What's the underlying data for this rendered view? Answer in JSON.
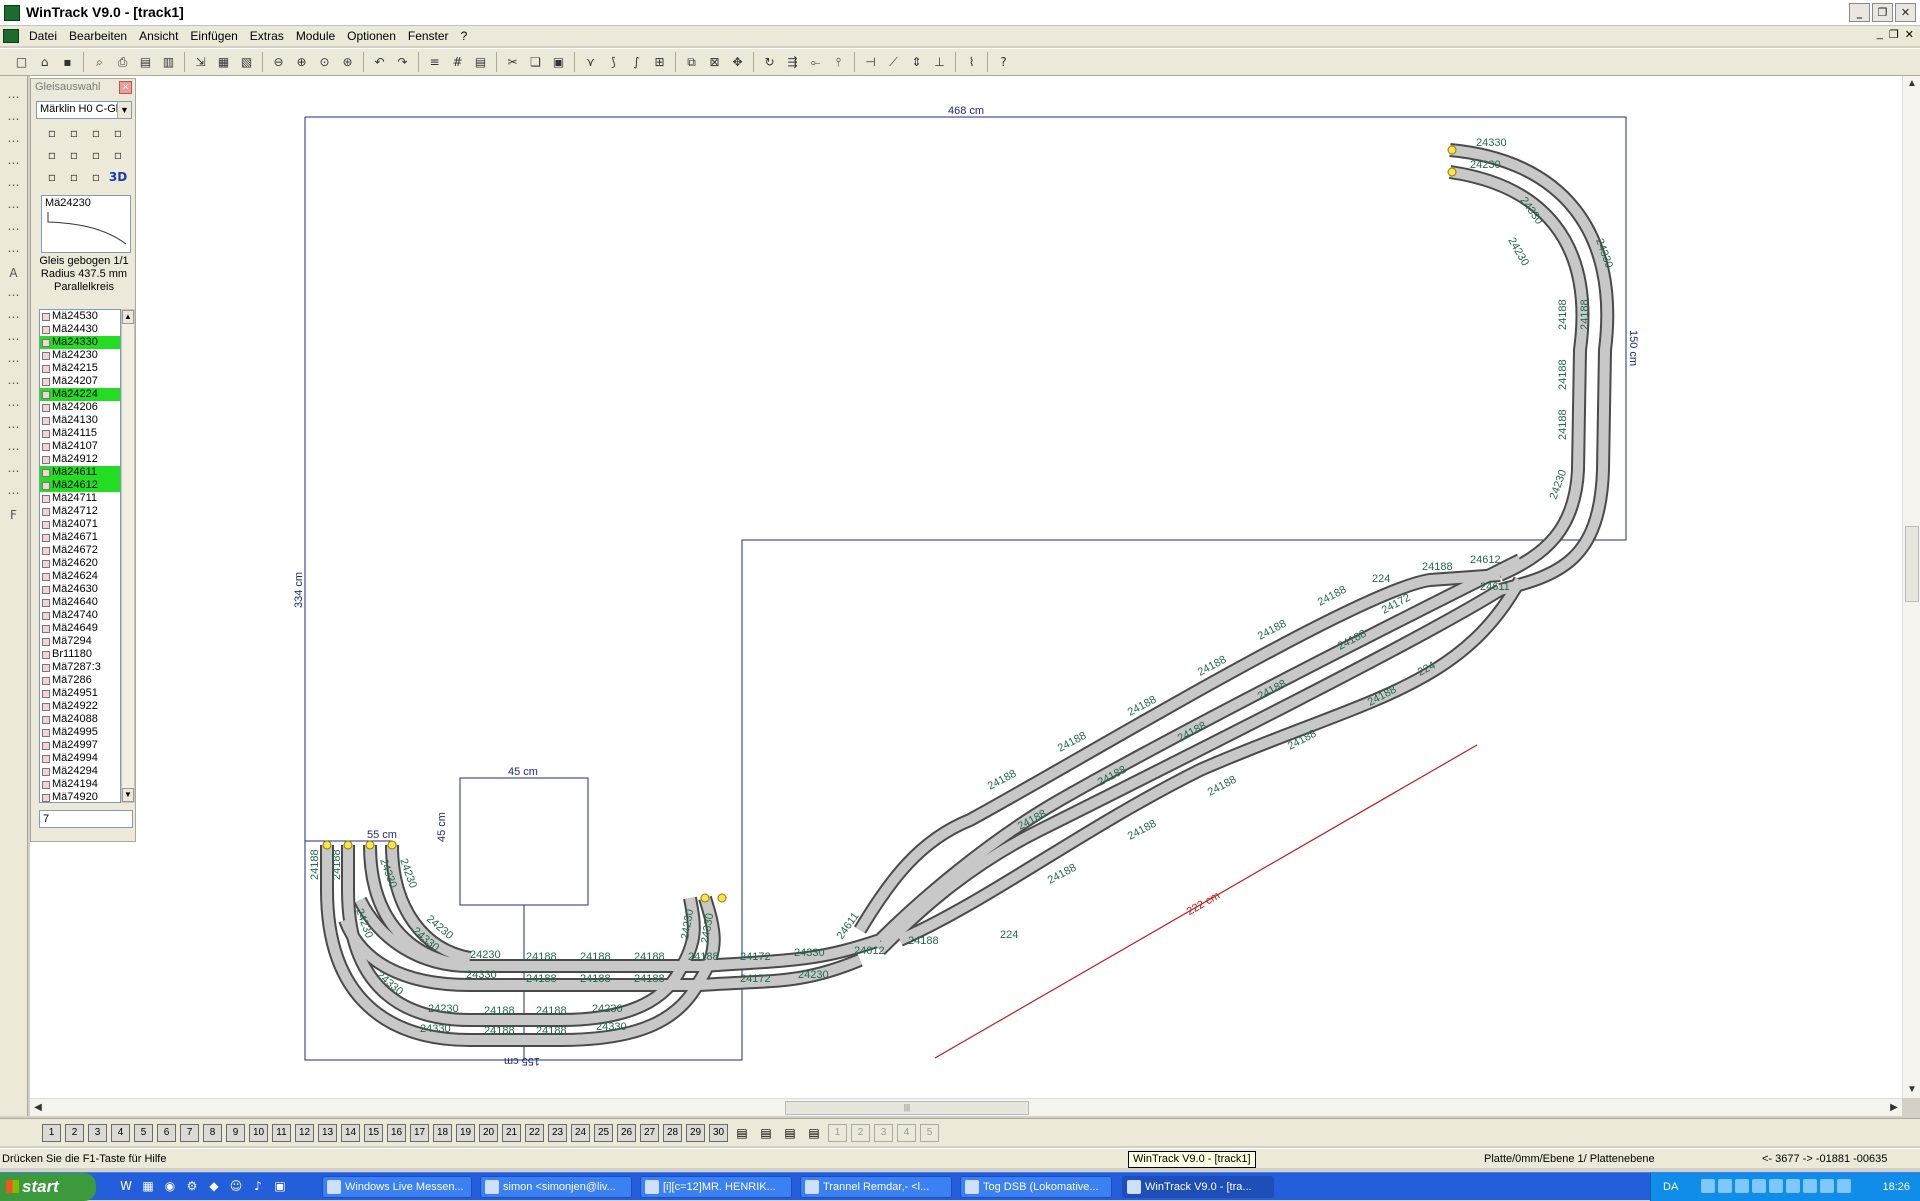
{
  "window": {
    "title": "WinTrack  V9.0 - [track1]"
  },
  "menu": [
    "Datei",
    "Bearbeiten",
    "Ansicht",
    "Einfügen",
    "Extras",
    "Module",
    "Optionen",
    "Fenster",
    "?"
  ],
  "toolbar_icons": [
    "new-icon",
    "open-icon",
    "save-icon",
    "print-preview-icon",
    "print-icon",
    "page-setup-icon",
    "properties-icon",
    "import-icon",
    "statistics-icon",
    "picture-icon",
    "zoom-out-icon",
    "zoom-in-icon",
    "zoom-window-icon",
    "zoom-all-icon",
    "undo-icon",
    "redo-icon",
    "parts-list-icon",
    "grid-icon",
    "table-icon",
    "cut-icon",
    "copy-icon",
    "paste-icon",
    "switch-icon",
    "curve-icon",
    "flex-icon",
    "insert-icon",
    "duplicate-icon",
    "delete-icon",
    "move-icon",
    "rotate-icon",
    "align-icon",
    "connect-icon",
    "split-icon",
    "join-icon",
    "slope-icon",
    "height-icon",
    "level-icon",
    "terrain-icon",
    "help-icon"
  ],
  "panel": {
    "title": "Gleisauswahl",
    "manufacturer": "Märklin H0 C-Gleis",
    "selected_item": "Mä24230",
    "info_lines": [
      "Gleis gebogen 1/1",
      "Radius 437.5 mm",
      "Parallelkreis"
    ],
    "list": [
      {
        "name": "Mä24530",
        "hl": false
      },
      {
        "name": "Mä24430",
        "hl": false
      },
      {
        "name": "Mä24330",
        "hl": true
      },
      {
        "name": "Mä24230",
        "hl": false
      },
      {
        "name": "Mä24215",
        "hl": false
      },
      {
        "name": "Mä24207",
        "hl": false
      },
      {
        "name": "Mä24224",
        "hl": true
      },
      {
        "name": "Mä24206",
        "hl": false
      },
      {
        "name": "Mä24130",
        "hl": false
      },
      {
        "name": "Mä24115",
        "hl": false
      },
      {
        "name": "Mä24107",
        "hl": false
      },
      {
        "name": "Mä24912",
        "hl": false
      },
      {
        "name": "Mä24611",
        "hl": true
      },
      {
        "name": "Mä24612",
        "hl": true
      },
      {
        "name": "Mä24711",
        "hl": false
      },
      {
        "name": "Mä24712",
        "hl": false
      },
      {
        "name": "Mä24071",
        "hl": false
      },
      {
        "name": "Mä24671",
        "hl": false
      },
      {
        "name": "Mä24672",
        "hl": false
      },
      {
        "name": "Mä24620",
        "hl": false
      },
      {
        "name": "Mä24624",
        "hl": false
      },
      {
        "name": "Mä24630",
        "hl": false
      },
      {
        "name": "Mä24640",
        "hl": false
      },
      {
        "name": "Mä24740",
        "hl": false
      },
      {
        "name": "Mä24649",
        "hl": false
      },
      {
        "name": "Mä7294",
        "hl": false
      },
      {
        "name": "Br11180",
        "hl": false
      },
      {
        "name": "Mä7287:3",
        "hl": false
      },
      {
        "name": "Mä7286",
        "hl": false
      },
      {
        "name": "Mä24951",
        "hl": false
      },
      {
        "name": "Mä24922",
        "hl": false
      },
      {
        "name": "Mä24088",
        "hl": false
      },
      {
        "name": "Mä24995",
        "hl": false
      },
      {
        "name": "Mä24997",
        "hl": false
      },
      {
        "name": "Mä24994",
        "hl": false
      },
      {
        "name": "Mä24294",
        "hl": false
      },
      {
        "name": "Mä24194",
        "hl": false
      },
      {
        "name": "Mä74920",
        "hl": false
      }
    ],
    "input_value": "7"
  },
  "dimensions": {
    "top": "468 cm",
    "right": "150 cm",
    "left": "334 cm",
    "bottom": "155 cm",
    "box_top": "45 cm",
    "box_side": "45 cm",
    "left_small": "55 cm",
    "diagonal": "222 cm"
  },
  "track_labels": {
    "top_a": "24330",
    "top_b": "24230",
    "right_a": "24188",
    "right_b": "24230",
    "right_c": "24330",
    "j1": "24612",
    "j2": "24611",
    "j3": "24172",
    "j4": "224",
    "diag": "24188",
    "turn_a": "24612",
    "turn_b": "24611",
    "bot_a": "24230",
    "bot_b": "24330",
    "bot_c": "24188",
    "bot_d": "24172",
    "left_a": "24188",
    "left_b": "24230",
    "left_c": "24330"
  },
  "layers": [
    "1",
    "2",
    "3",
    "4",
    "5",
    "6",
    "7",
    "8",
    "9",
    "10",
    "11",
    "12",
    "13",
    "14",
    "15",
    "16",
    "17",
    "18",
    "19",
    "20",
    "21",
    "22",
    "23",
    "24",
    "25",
    "26",
    "27",
    "28",
    "29",
    "30"
  ],
  "layers_dim": [
    "1",
    "2",
    "3",
    "4",
    "5"
  ],
  "status": {
    "help": "Drücken Sie die  F1-Taste für Hilfe",
    "layer": "Platte/0mm/Ebene 1/ Plattenebene",
    "coords": "<- 3677 ->   -01881   -00635"
  },
  "tooltip": "WinTrack  V9.0 - [track1]",
  "taskbar": {
    "start": "start",
    "tasks": [
      "Windows Live Messen...",
      "simon <simonjen@liv...",
      "[i][c=12]MR. HENRIK...",
      "Trannel Remdar,- <l...",
      "Tog DSB (Lokomative...",
      "WinTrack  V9.0 - [tra..."
    ],
    "lang": "DA",
    "clock": "18:26"
  }
}
